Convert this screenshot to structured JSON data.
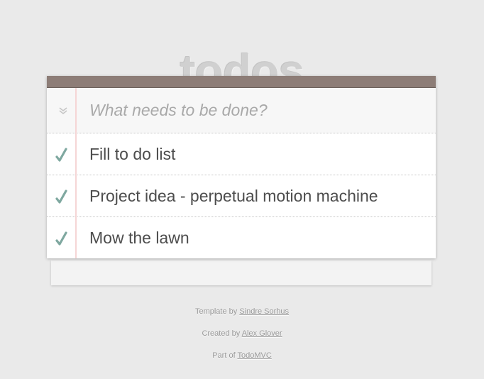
{
  "app": {
    "title": "todos"
  },
  "new_todo": {
    "placeholder": "What needs to be done?",
    "value": "",
    "toggle_all_icon": "double-chevron-down-icon"
  },
  "todos": [
    {
      "label": "Fill to do list",
      "check_icon": "checkmark-icon"
    },
    {
      "label": "Project idea - perpetual motion machine",
      "check_icon": "checkmark-icon"
    },
    {
      "label": "Mow the lawn",
      "check_icon": "checkmark-icon"
    }
  ],
  "footer": {
    "line1_prefix": "Template by ",
    "line1_link": "Sindre Sorhus",
    "line2_prefix": "Created by ",
    "line2_link": "Alex Glover",
    "line3_prefix": "Part of ",
    "line3_link": "TodoMVC"
  },
  "colors": {
    "header_bar": "#8d7d77",
    "check": "#7fa8a0",
    "title": "#d0d0d0",
    "margin_line": "#f5d6d6"
  }
}
